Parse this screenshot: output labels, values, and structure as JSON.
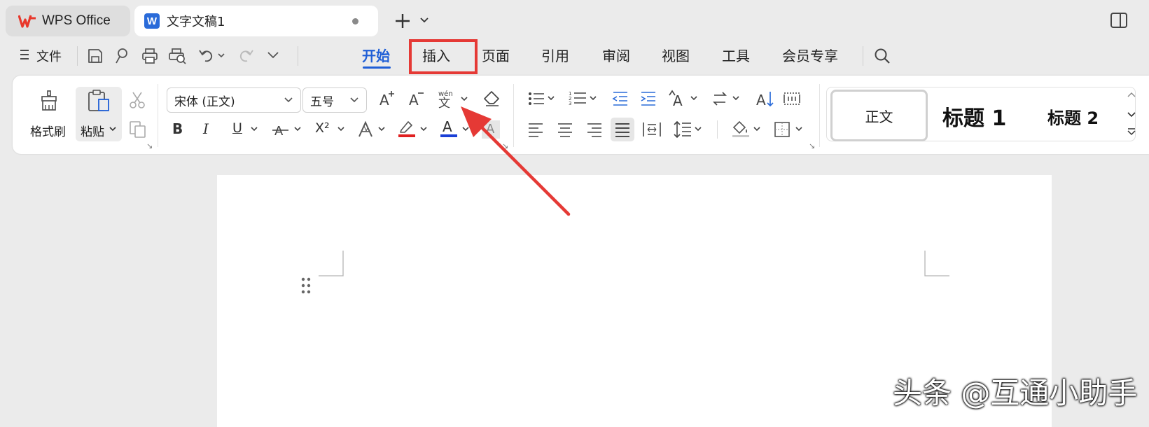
{
  "titlebar": {
    "app_tab_label": "WPS Office",
    "doc_tab_label": "文字文稿1",
    "doc_tab_letter": "W"
  },
  "menu": {
    "file_label": "文件",
    "tabs": [
      {
        "label": "开始",
        "active": true
      },
      {
        "label": "插入",
        "active": false
      },
      {
        "label": "页面",
        "active": false
      },
      {
        "label": "引用",
        "active": false
      },
      {
        "label": "审阅",
        "active": false
      },
      {
        "label": "视图",
        "active": false
      },
      {
        "label": "工具",
        "active": false
      },
      {
        "label": "会员专享",
        "active": false
      }
    ]
  },
  "ribbon": {
    "format_painter_label": "格式刷",
    "paste_label": "粘贴",
    "font_name": "宋体 (正文)",
    "font_size": "五号",
    "bold": "B",
    "italic": "I",
    "underline": "U",
    "superscript": "X²",
    "font_color_letter": "A",
    "styles": {
      "normal": "正文",
      "heading1": "标题 1",
      "heading2": "标题 2"
    }
  },
  "watermark": "头条 @互通小助手",
  "colors": {
    "accent": "#1f5ed6",
    "highlight_box": "#e53935",
    "arrow": "#e53935",
    "font_color_bar": "#1a3fd6",
    "highlight_color_bar": "#e02020",
    "wps_logo": "#e8372b"
  }
}
